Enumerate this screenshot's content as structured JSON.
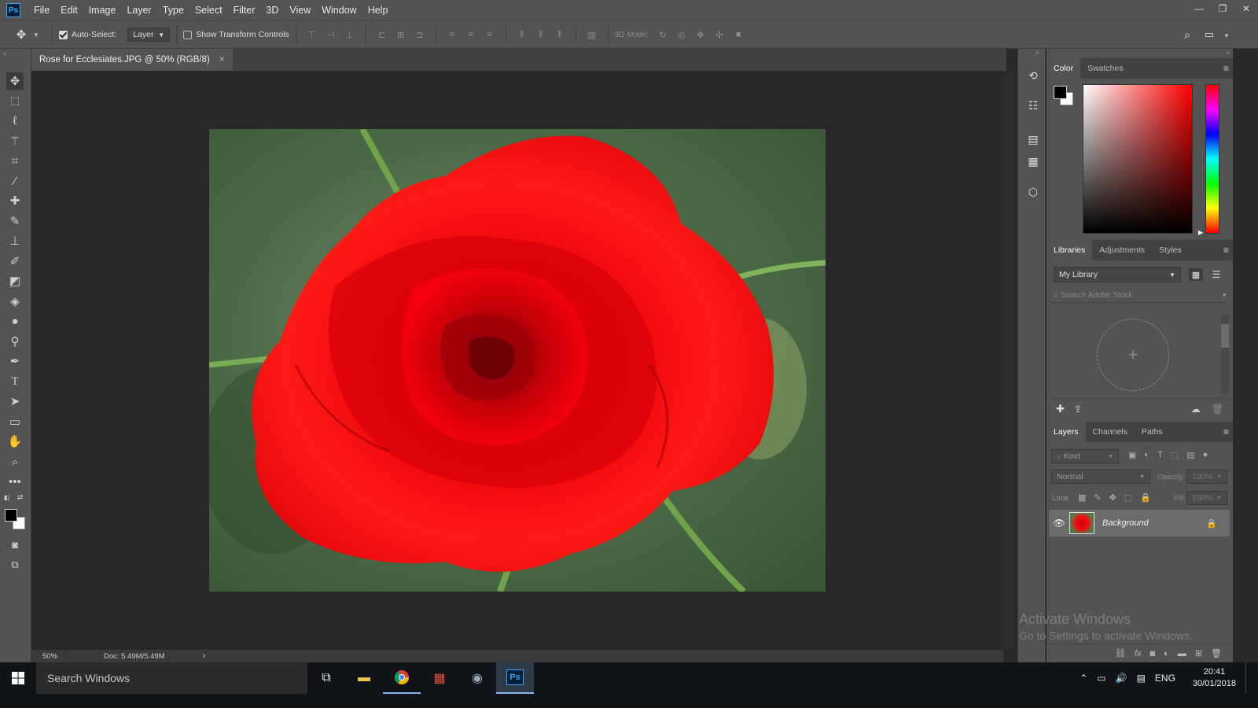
{
  "app": {
    "name": "Ps"
  },
  "menu": [
    "File",
    "Edit",
    "Image",
    "Layer",
    "Type",
    "Select",
    "Filter",
    "3D",
    "View",
    "Window",
    "Help"
  ],
  "window_controls": [
    "—",
    "❐",
    "✕"
  ],
  "options": {
    "auto_select_label": "Auto-Select:",
    "auto_select_checked": true,
    "auto_select_value": "Layer",
    "transform_label": "Show Transform Controls",
    "transform_checked": false,
    "mode_3d_label": "3D Mode:"
  },
  "document": {
    "tab_title": "Rose for Ecclesiates.JPG @ 50% (RGB/8)",
    "close_label": "×",
    "image_description": "red rose"
  },
  "status": {
    "zoom": "50%",
    "doc": "Doc: 5.49M/5.49M",
    "arrow": "›"
  },
  "color_panel": {
    "tabs": [
      "Color",
      "Swatches"
    ],
    "foreground": "#000000",
    "background": "#ffffff",
    "picker_hue": "#ff0000"
  },
  "libraries_panel": {
    "tabs": [
      "Libraries",
      "Adjustments",
      "Styles"
    ],
    "library_name": "My Library",
    "search_placeholder": "Search Adobe Stock",
    "add_label": "+"
  },
  "layers_panel": {
    "tabs": [
      "Layers",
      "Channels",
      "Paths"
    ],
    "kind_placeholder": "Kind",
    "blend_mode": "Normal",
    "opacity_label": "Opacity:",
    "opacity_value": "100%",
    "lock_label": "Lock:",
    "fill_label": "Fill:",
    "fill_value": "100%",
    "layers": [
      {
        "name": "Background",
        "visible": true,
        "locked": true
      }
    ]
  },
  "watermark": {
    "title": "Activate Windows",
    "subtitle": "Go to Settings to activate Windows."
  },
  "taskbar": {
    "search_placeholder": "Search Windows",
    "language": "ENG",
    "time": "20:41",
    "date": "30/01/2018",
    "ps_label": "Ps"
  }
}
